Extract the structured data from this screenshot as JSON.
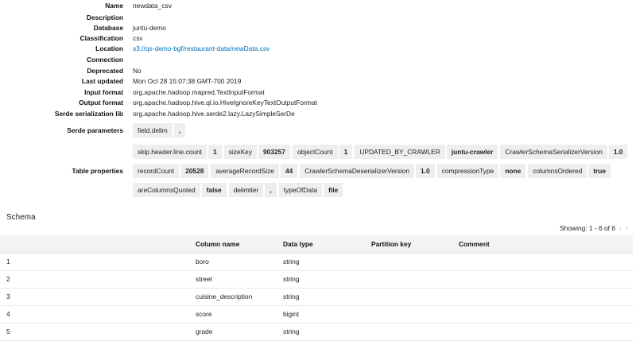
{
  "details": [
    {
      "label": "Name",
      "value": "newdata_csv"
    },
    {
      "label": "Description",
      "value": ""
    },
    {
      "label": "Database",
      "value": "juntu-demo"
    },
    {
      "label": "Classification",
      "value": "csv"
    },
    {
      "label": "Location",
      "value": "s3://qs-demo-bgf/restaurant-data/newData.csv"
    },
    {
      "label": "Connection",
      "value": ""
    },
    {
      "label": "Deprecated",
      "value": "No"
    },
    {
      "label": "Last updated",
      "value": "Mon Oct 28 15:07:38 GMT-700 2019"
    },
    {
      "label": "Input format",
      "value": "org.apache.hadoop.mapred.TextInputFormat"
    },
    {
      "label": "Output format",
      "value": "org.apache.hadoop.hive.ql.io.HiveIgnoreKeyTextOutputFormat"
    },
    {
      "label": "Serde serialization lib",
      "value": "org.apache.hadoop.hive.serde2.lazy.LazySimpleSerDe"
    }
  ],
  "serde": {
    "label": "Serde parameters",
    "params": [
      {
        "key": "field.delim",
        "value": ","
      }
    ]
  },
  "table_props": {
    "label": "Table properties",
    "rows": [
      [
        {
          "key": "skip.header.line.count",
          "value": "1"
        },
        {
          "key": "sizeKey",
          "value": "903257"
        },
        {
          "key": "objectCount",
          "value": "1"
        },
        {
          "key": "UPDATED_BY_CRAWLER",
          "value": "juntu-crawler"
        },
        {
          "key": "CrawlerSchemaSerializerVersion",
          "value": "1.0"
        }
      ],
      [
        {
          "key": "recordCount",
          "value": "20528"
        },
        {
          "key": "averageRecordSize",
          "value": "44"
        },
        {
          "key": "CrawlerSchemaDeserializerVersion",
          "value": "1.0"
        },
        {
          "key": "compressionType",
          "value": "none"
        },
        {
          "key": "columnsOrdered",
          "value": "true"
        }
      ],
      [
        {
          "key": "areColumnsQuoted",
          "value": "false"
        },
        {
          "key": "delimiter",
          "value": ","
        },
        {
          "key": "typeOfData",
          "value": "file"
        }
      ]
    ]
  },
  "schema": {
    "title": "Schema",
    "showing": "Showing: 1 - 6 of 6",
    "headers": [
      "",
      "Column name",
      "Data type",
      "Partition key",
      "Comment"
    ],
    "rows": [
      [
        "1",
        "boro",
        "string",
        "",
        ""
      ],
      [
        "2",
        "street",
        "string",
        "",
        ""
      ],
      [
        "3",
        "cuisine_description",
        "string",
        "",
        ""
      ],
      [
        "4",
        "score",
        "bigint",
        "",
        ""
      ],
      [
        "5",
        "grade",
        "string",
        "",
        ""
      ]
    ]
  },
  "icons": {
    "prev": "chevron-left-icon",
    "next": "chevron-right-icon"
  },
  "colors": {
    "link": "#0073bb",
    "tag_bg": "#eeeeee",
    "header_bg": "#f2f3f3"
  }
}
